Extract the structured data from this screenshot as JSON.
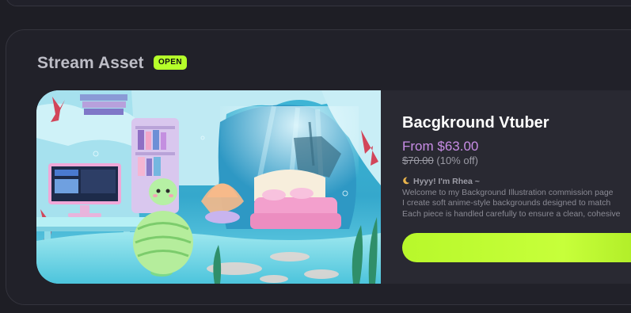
{
  "section": {
    "title": "Stream Asset",
    "badge": "OPEN"
  },
  "listing": {
    "thumbnail": "underwater-vtuber-bedroom-illustration",
    "title": "Bacgkround Vtuber",
    "price": "From $63.00",
    "original_price": "$70.00",
    "discount": "(10% off)",
    "description_heading": "Hyyy! I'm Rhea ~",
    "description_lines": [
      "Welcome to my Background Illustration commission page",
      "I create soft anime-style backgrounds designed to match",
      "Each piece is handled carefully to ensure a clean, cohesive"
    ],
    "cta_label": ""
  },
  "colors": {
    "page_bg": "#1e1e25",
    "badge_bg": "#b5ff2a",
    "price": "#c88de6",
    "cta": "#b8f82b"
  },
  "icons": {
    "description_heading": "crescent-moon-icon"
  }
}
